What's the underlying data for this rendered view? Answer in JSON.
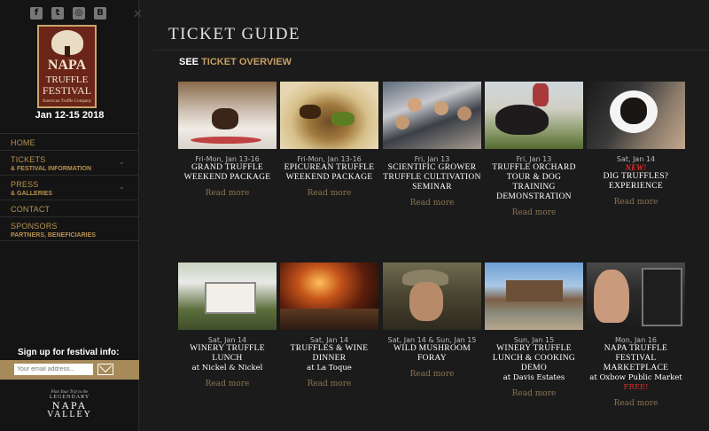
{
  "sidebar": {
    "social": [
      "facebook-icon",
      "twitter-icon",
      "instagram-icon",
      "blogger-icon"
    ],
    "close_icon": "close-icon",
    "logo": {
      "line1": "NAPA",
      "line2": "TRUFFLE",
      "line3": "FESTIVAL",
      "line4": "American Truffle Company"
    },
    "dates": "Jan 12-15 2018",
    "nav": [
      {
        "main": "HOME",
        "sub": ""
      },
      {
        "main": "TICKETS",
        "sub": "& FESTIVAL INFORMATION"
      },
      {
        "main": "PRESS",
        "sub": "& GALLERIES"
      },
      {
        "main": "CONTACT",
        "sub": ""
      },
      {
        "main": "SPONSORS",
        "sub": "PARTNERS, BENEFICIARIES"
      }
    ],
    "signup_label": "Sign up for festival info:",
    "email_placeholder": "Your email address...",
    "plan": {
      "line1": "Plan Your Trip to the",
      "line2": "LEGENDARY",
      "line3": "NAPA",
      "line4": "VALLEY"
    }
  },
  "main": {
    "title": "TICKET GUIDE",
    "see_prefix": "SEE ",
    "see_link": "TICKET OVERVIEW",
    "read_more": "Read more",
    "cards": [
      {
        "date": "Fri-Mon, Jan 13-16",
        "title": "Grand Truffle Weekend Package",
        "venue": "",
        "new": "",
        "free": ""
      },
      {
        "date": "Fri-Mon, Jan 13-16",
        "title": "Epicurean Truffle Weekend Package",
        "venue": "",
        "new": "",
        "free": ""
      },
      {
        "date": "Fri, Jan 13",
        "title": "Scientific Grower Truffle Cultivation Seminar",
        "venue": "",
        "new": "",
        "free": ""
      },
      {
        "date": "Fri, Jan 13",
        "title": "Truffle Orchard Tour & Dog Training Demonstration",
        "venue": "",
        "new": "",
        "free": ""
      },
      {
        "date": "Sat, Jan 14",
        "title": "Dig Truffles? Experience",
        "venue": "",
        "new": "NEW!",
        "free": ""
      },
      {
        "date": "Sat, Jan 14",
        "title": "Winery Truffle Lunch",
        "venue": "at Nickel & Nickel",
        "new": "",
        "free": ""
      },
      {
        "date": "Sat, Jan 14",
        "title": "Truffles & Wine Dinner",
        "venue": "at La Toque",
        "new": "",
        "free": ""
      },
      {
        "date": "Sat, Jan 14 & Sun, Jan 15",
        "title": "Wild Mushroom Foray",
        "venue": "",
        "new": "",
        "free": ""
      },
      {
        "date": "Sun, Jan 15",
        "title": "Winery Truffle Lunch & Cooking Demo",
        "venue": "at Davis Estates",
        "new": "",
        "free": ""
      },
      {
        "date": "Mon, Jan 16",
        "title": "Napa Truffle Festival Marketplace",
        "venue": "at Oxbow Public Market",
        "new": "",
        "free": "FREE!"
      }
    ]
  }
}
